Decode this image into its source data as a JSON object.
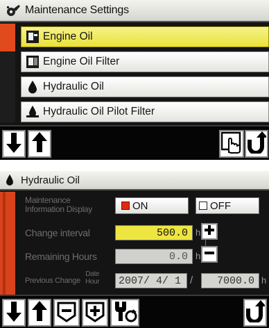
{
  "screen1": {
    "title": "Maintenance Settings",
    "title_icon": "wrench-gear-icon",
    "items": [
      {
        "label": "Engine Oil",
        "icon": "oil-can-icon",
        "selected": true
      },
      {
        "label": "Engine Oil Filter",
        "icon": "filter-can-icon",
        "selected": false
      },
      {
        "label": "Hydraulic Oil",
        "icon": "oil-drop-icon",
        "selected": false
      },
      {
        "label": "Hydraulic Oil Pilot Filter",
        "icon": "drop-filter-icon",
        "selected": false
      }
    ],
    "buttons": [
      "arrow-down-icon",
      "arrow-up-icon",
      "hand-select-icon",
      "back-return-icon"
    ]
  },
  "screen2": {
    "title": "Hydraulic Oil",
    "title_icon": "oil-drop-icon",
    "maint_label_line1": "Maintenance",
    "maint_label_line2": "Information Display",
    "on_label": "ON",
    "off_label": "OFF",
    "change_interval_label": "Change interval",
    "change_interval_value": "500.0",
    "change_interval_unit": "h",
    "remaining_label": "Remaining Hours",
    "remaining_value": "0.0",
    "remaining_unit": "h",
    "prev_change_label": "Previous Change",
    "date_label": "Date",
    "hour_label": "Hour",
    "prev_date_value": "2007/ 4/ 1",
    "separator": "/",
    "prev_hour_value": "7000.0",
    "prev_hour_unit": "h",
    "buttons": [
      "arrow-down-icon",
      "arrow-up-icon",
      "minus-box-icon",
      "plus-box-icon",
      "reset-wrench-icon",
      "back-return-icon"
    ],
    "colors": {
      "accent": "#e04a1c",
      "highlight": "#ede540",
      "on_indicator": "#e02a10"
    }
  }
}
